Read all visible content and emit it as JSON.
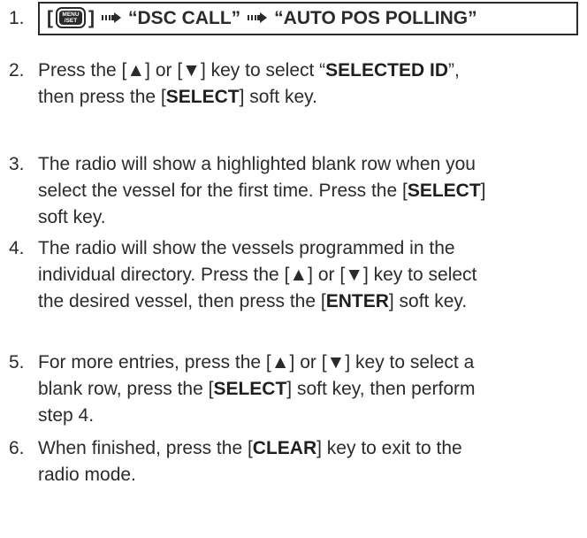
{
  "steps": [
    {
      "num": "1.",
      "key": {
        "bracket_open": "[",
        "line1": "MENU",
        "line2": "/SET",
        "bracket_close": "]"
      },
      "path": [
        "“DSC CALL”",
        "“AUTO POS POLLING”"
      ]
    },
    {
      "num": "2.",
      "line1": [
        "Press the [▲] or [▼] key to select “",
        "SELECTED ID",
        "”,"
      ],
      "line2": [
        "then press the [",
        "SELECT",
        "] soft key."
      ]
    },
    {
      "num": "3.",
      "line1": "The radio will show a  highlighted blank row when you",
      "line2": [
        "select the vessel for the first time. Press the [",
        "SELECT",
        "]"
      ],
      "line3": "soft key."
    },
    {
      "num": "4.",
      "line1": "The radio will show the vessels programmed in the",
      "line2": "individual directory. Press the [▲] or [▼] key to select",
      "line3": [
        "the desired vessel, then press the [",
        "ENTER",
        "] soft key."
      ]
    },
    {
      "num": "5.",
      "line1": "For more entries, press the [▲] or [▼] key to select a",
      "line2": [
        "blank row, press the [",
        "SELECT",
        "] soft key, then perform"
      ],
      "line3": "step 4."
    },
    {
      "num": "6.",
      "line1": [
        "When finished, press the [",
        "CLEAR",
        "] key to exit to the"
      ],
      "line2": "radio mode."
    }
  ]
}
